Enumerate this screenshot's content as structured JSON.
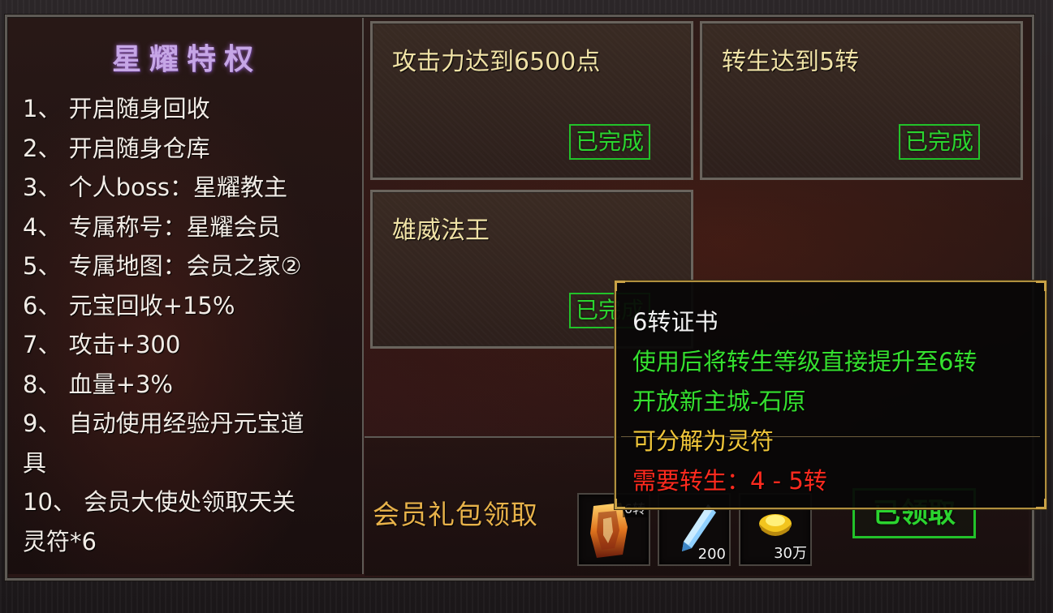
{
  "privileges": {
    "title": "星耀特权",
    "items": [
      "1、 开启随身回收",
      "2、 开启随身仓库",
      "3、 个人boss：星耀教主",
      "4、 专属称号：星耀会员",
      "5、 专属地图：会员之家②",
      "6、 元宝回收+15%",
      "7、 攻击+300",
      "8、 血量+3%",
      "9、 自动使用经验丹元宝道",
      "具",
      "10、 会员大使处领取天关",
      "灵符*6"
    ]
  },
  "tasks": [
    {
      "title": "攻击力达到6500点",
      "status": "已完成"
    },
    {
      "title": "转生达到5转",
      "status": "已完成"
    },
    {
      "title": "雄威法王",
      "status": "已完成"
    }
  ],
  "gift": {
    "label": "会员礼包领取",
    "items": [
      {
        "name": "6转证书",
        "badge": "6转",
        "icon": "scroll-certificate-icon"
      },
      {
        "name": "crystal",
        "qty": "200",
        "icon": "blue-crystal-icon"
      },
      {
        "name": "gold",
        "qty": "30万",
        "icon": "gold-ingot-icon"
      }
    ],
    "claim_label": "已领取"
  },
  "tooltip": {
    "title": "6转证书",
    "line1": "使用后将转生等级直接提升至6转",
    "line2": "开放新主城-石原",
    "line3": "可分解为灵符",
    "line4": "需要转生：4 - 5转"
  },
  "colors": {
    "title": "#c6a6e6",
    "task_title": "#f0e2a6",
    "done": "#2bd42f",
    "gift_label": "#e8b24a",
    "tip_white": "#f2f2f2",
    "tip_green": "#35e02f",
    "tip_yellow": "#f0c63a",
    "tip_red": "#ff2a1e"
  }
}
